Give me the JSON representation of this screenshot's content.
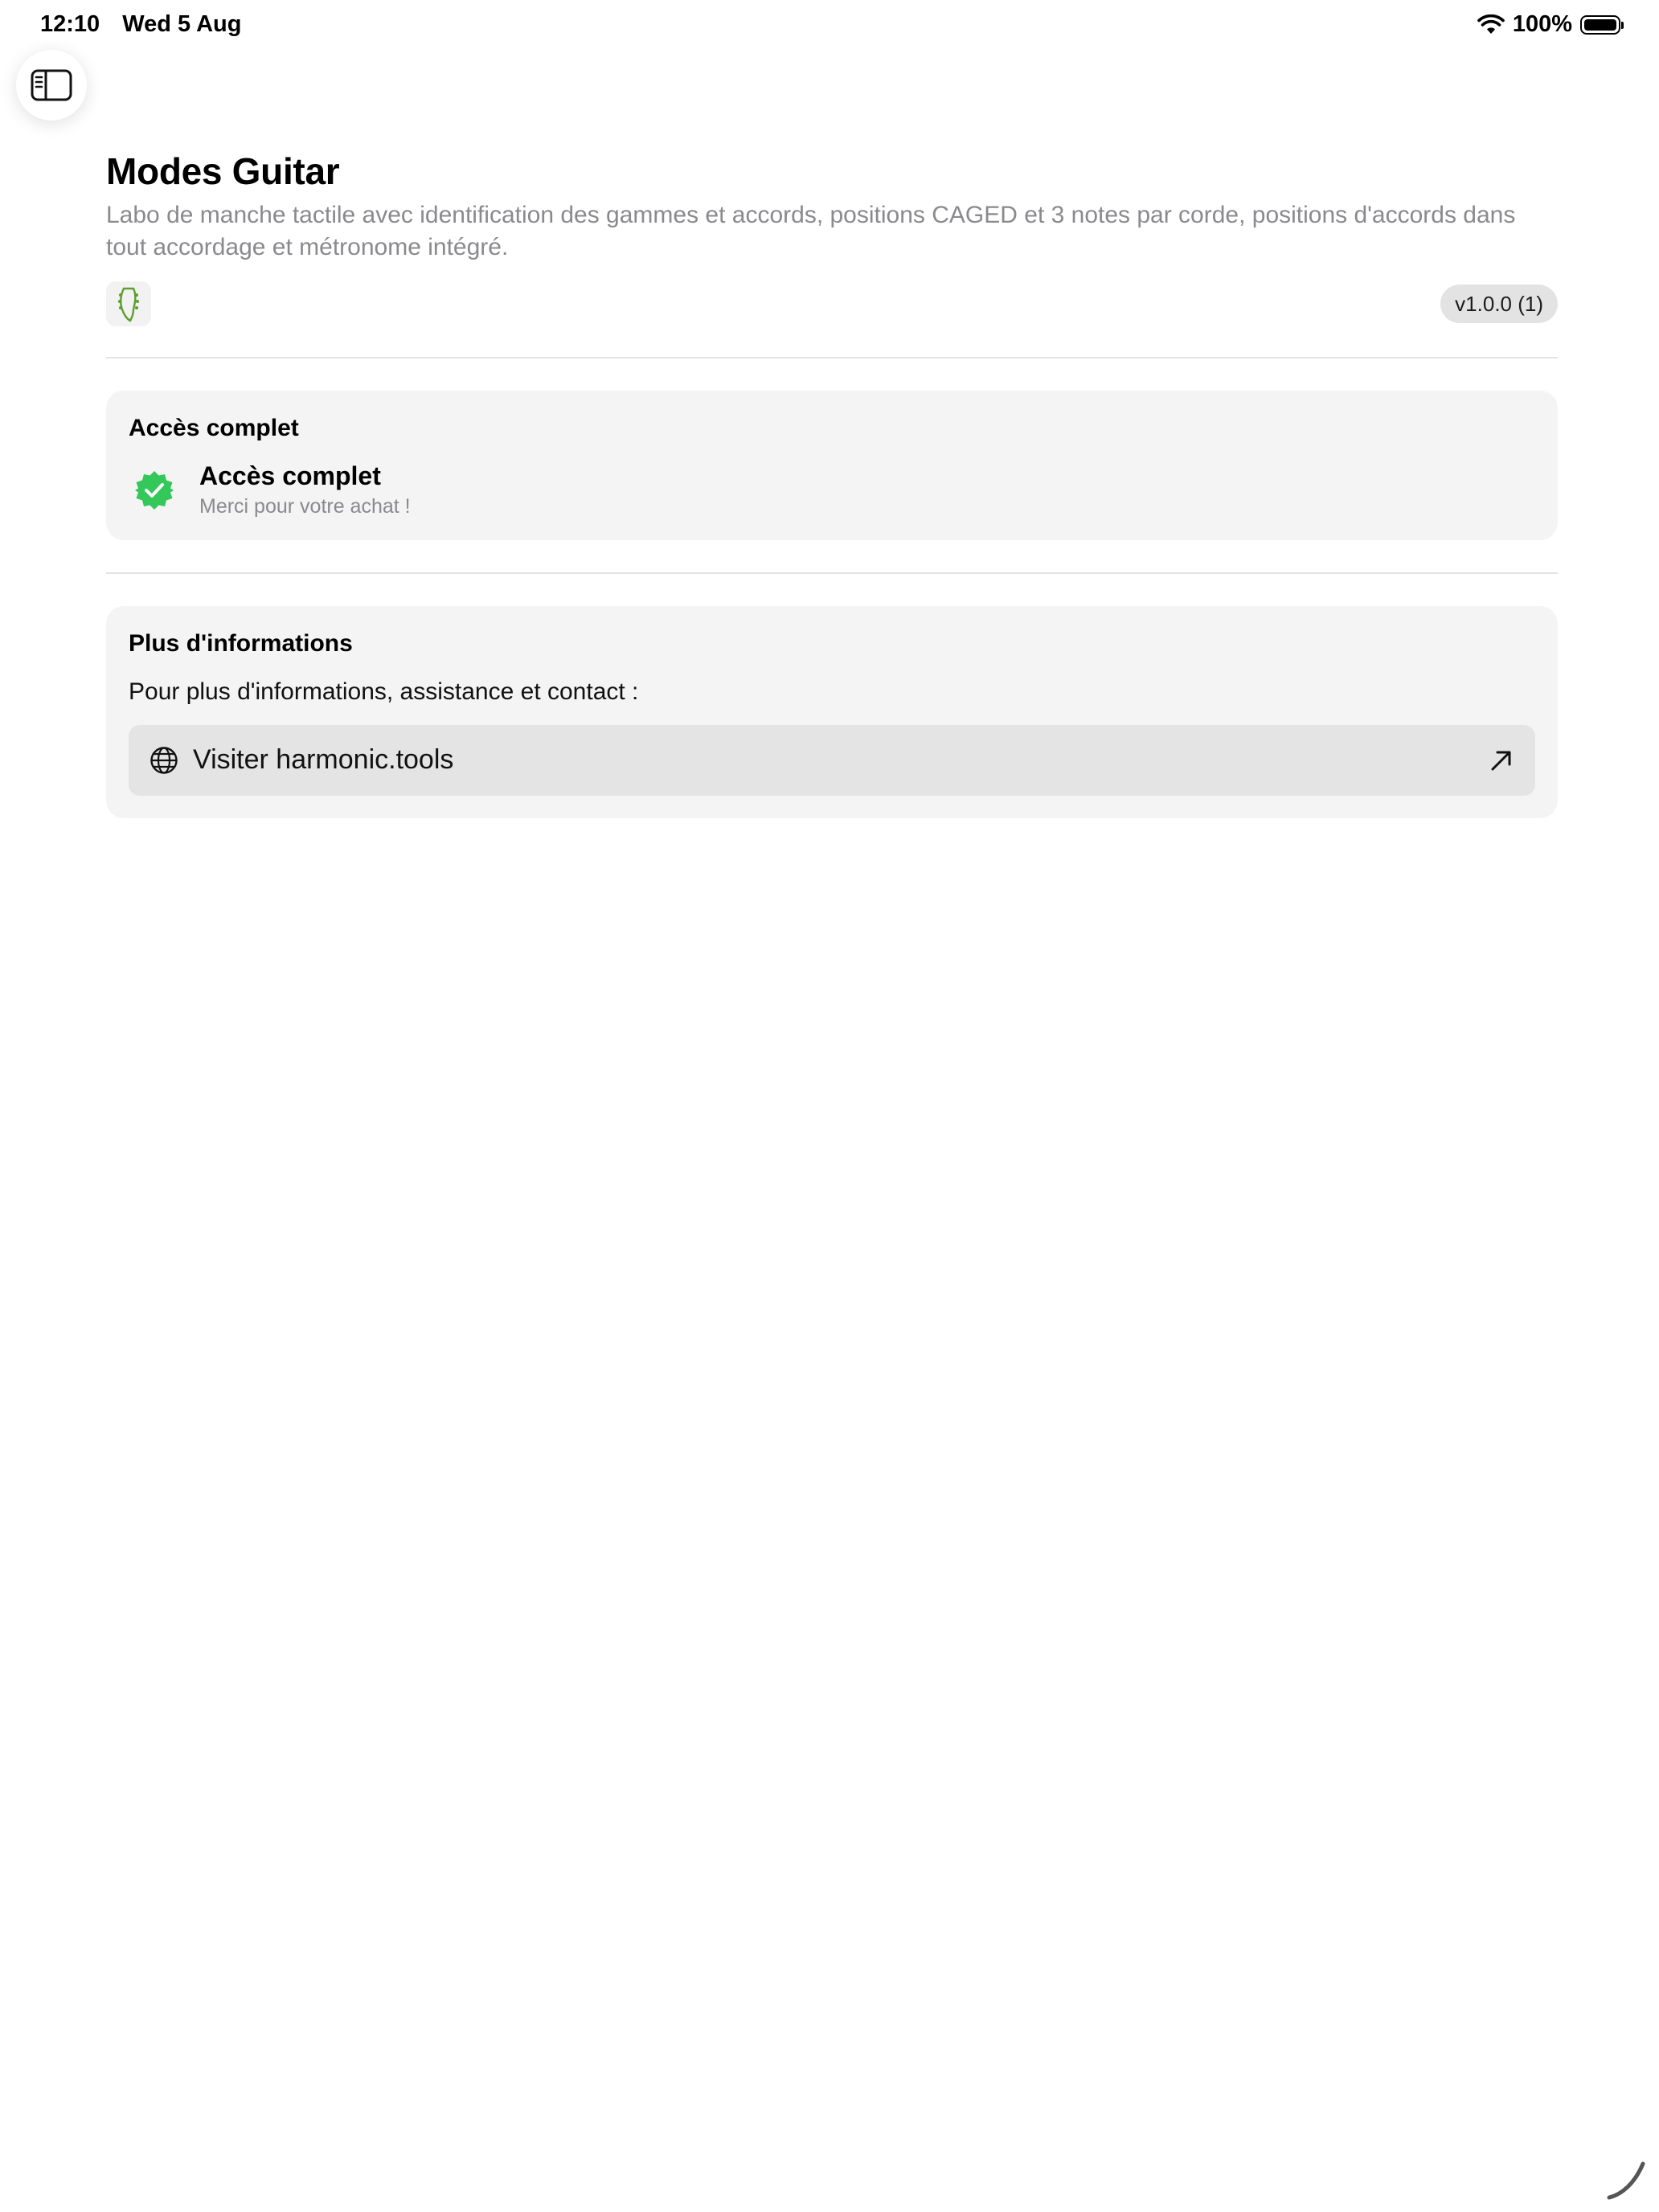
{
  "status_bar": {
    "time": "12:10",
    "date": "Wed 5 Aug",
    "battery_percent": "100%",
    "wifi_icon": "wifi-icon",
    "battery_icon": "battery-icon"
  },
  "sidebar_toggle": {
    "icon": "sidebar-icon"
  },
  "header": {
    "title": "Modes Guitar",
    "subtitle": "Labo de manche tactile avec identification des gammes et accords, positions CAGED et 3 notes par corde, positions d'accords dans tout accordage et métronome intégré.",
    "app_icon": "guitar-headstock-icon",
    "version": "v1.0.0 (1)"
  },
  "access_card": {
    "title": "Accès complet",
    "item_title": "Accès complet",
    "item_subtitle": "Merci pour votre achat !",
    "icon": "verified-badge-icon",
    "icon_color": "#34c759"
  },
  "info_card": {
    "title": "Plus d'informations",
    "text": "Pour plus d'informations, assistance et contact :",
    "link_label": "Visiter harmonic.tools",
    "link_icon": "globe-icon",
    "external_icon": "arrow-up-right-icon"
  },
  "colors": {
    "accent_green": "#34c759",
    "card_background": "#f4f4f4",
    "secondary_text": "#8a8a8e"
  }
}
